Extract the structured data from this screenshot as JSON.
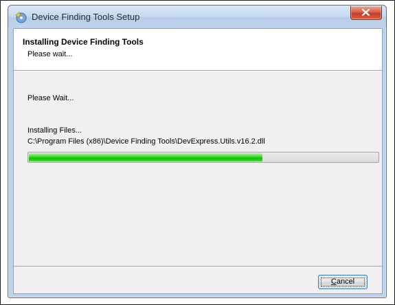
{
  "window": {
    "title": "Device Finding Tools Setup",
    "close_glyph": "x",
    "icon": "installer-icon"
  },
  "header": {
    "title": "Installing Device Finding Tools",
    "subtitle": "Please wait..."
  },
  "body": {
    "status": "Please Wait...",
    "action": "Installing Files...",
    "current_file": "C:\\Program Files (x86)\\Device Finding Tools\\DevExpress.Utils.v16.2.dll"
  },
  "progress": {
    "percent": 67,
    "color": "#27c21a"
  },
  "buttons": {
    "cancel_label": "Cancel",
    "cancel_mnemonic": "C"
  }
}
